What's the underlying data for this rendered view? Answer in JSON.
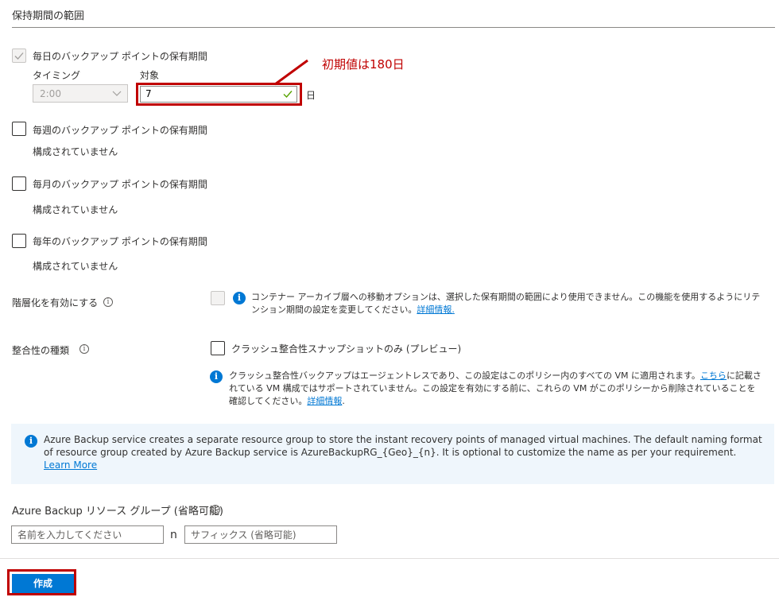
{
  "section": {
    "title": "保持期間の範囲"
  },
  "daily": {
    "label": "毎日のバックアップ ポイントの保有期間",
    "timing_label": "タイミング",
    "timing_value": "2:00",
    "target_label": "対象",
    "target_value": "7",
    "unit": "日",
    "checked": true
  },
  "annotation": {
    "text": "初期値は180日",
    "color": "#c00000"
  },
  "weekly": {
    "label": "毎週のバックアップ ポイントの保有期間",
    "status": "構成されていません"
  },
  "monthly": {
    "label": "毎月のバックアップ ポイントの保有期間",
    "status": "構成されていません"
  },
  "yearly": {
    "label": "毎年のバックアップ ポイントの保有期間",
    "status": "構成されていません"
  },
  "tiering": {
    "label": "階層化を有効にする",
    "info_text": "コンテナー アーカイブ層への移動オプションは、選択した保有期間の範囲により使用できません。この機能を使用するようにリテンション期間の設定を変更してください。",
    "link": "詳細情報."
  },
  "consistency": {
    "label": "整合性の種類",
    "option_label": "クラッシュ整合性スナップショットのみ (プレビュー)",
    "info_text_1": "クラッシュ整合性バックアップはエージェントレスであり、この設定はこのポリシー内のすべての VM に適用されます。",
    "info_link_1": "こちら",
    "info_text_2": "に記載されている VM 構成ではサポートされていません。この設定を有効にする前に、これらの VM がこのポリシーから削除されていることを確認してください。",
    "info_link_2": "詳細情報",
    "info_text_3": "."
  },
  "banner": {
    "text": "Azure Backup service creates a separate resource group to store the instant recovery points of managed virtual machines. The default naming format of resource group created by Azure Backup service is AzureBackupRG_{Geo}_{n}. It is optional to customize the name as per your requirement. ",
    "link": "Learn More"
  },
  "resource_group": {
    "label": "Azure Backup リソース グループ (省略可能)",
    "name_placeholder": "名前を入力してください",
    "separator": "n",
    "suffix_placeholder": "サフィックス (省略可能)"
  },
  "actions": {
    "create_label": "作成"
  },
  "colors": {
    "accent": "#0078d4",
    "highlight": "#c00000",
    "banner_bg": "#eff6fc"
  },
  "icons": [
    "check-icon",
    "chevron-down-icon",
    "info-icon",
    "info-filled-icon"
  ]
}
